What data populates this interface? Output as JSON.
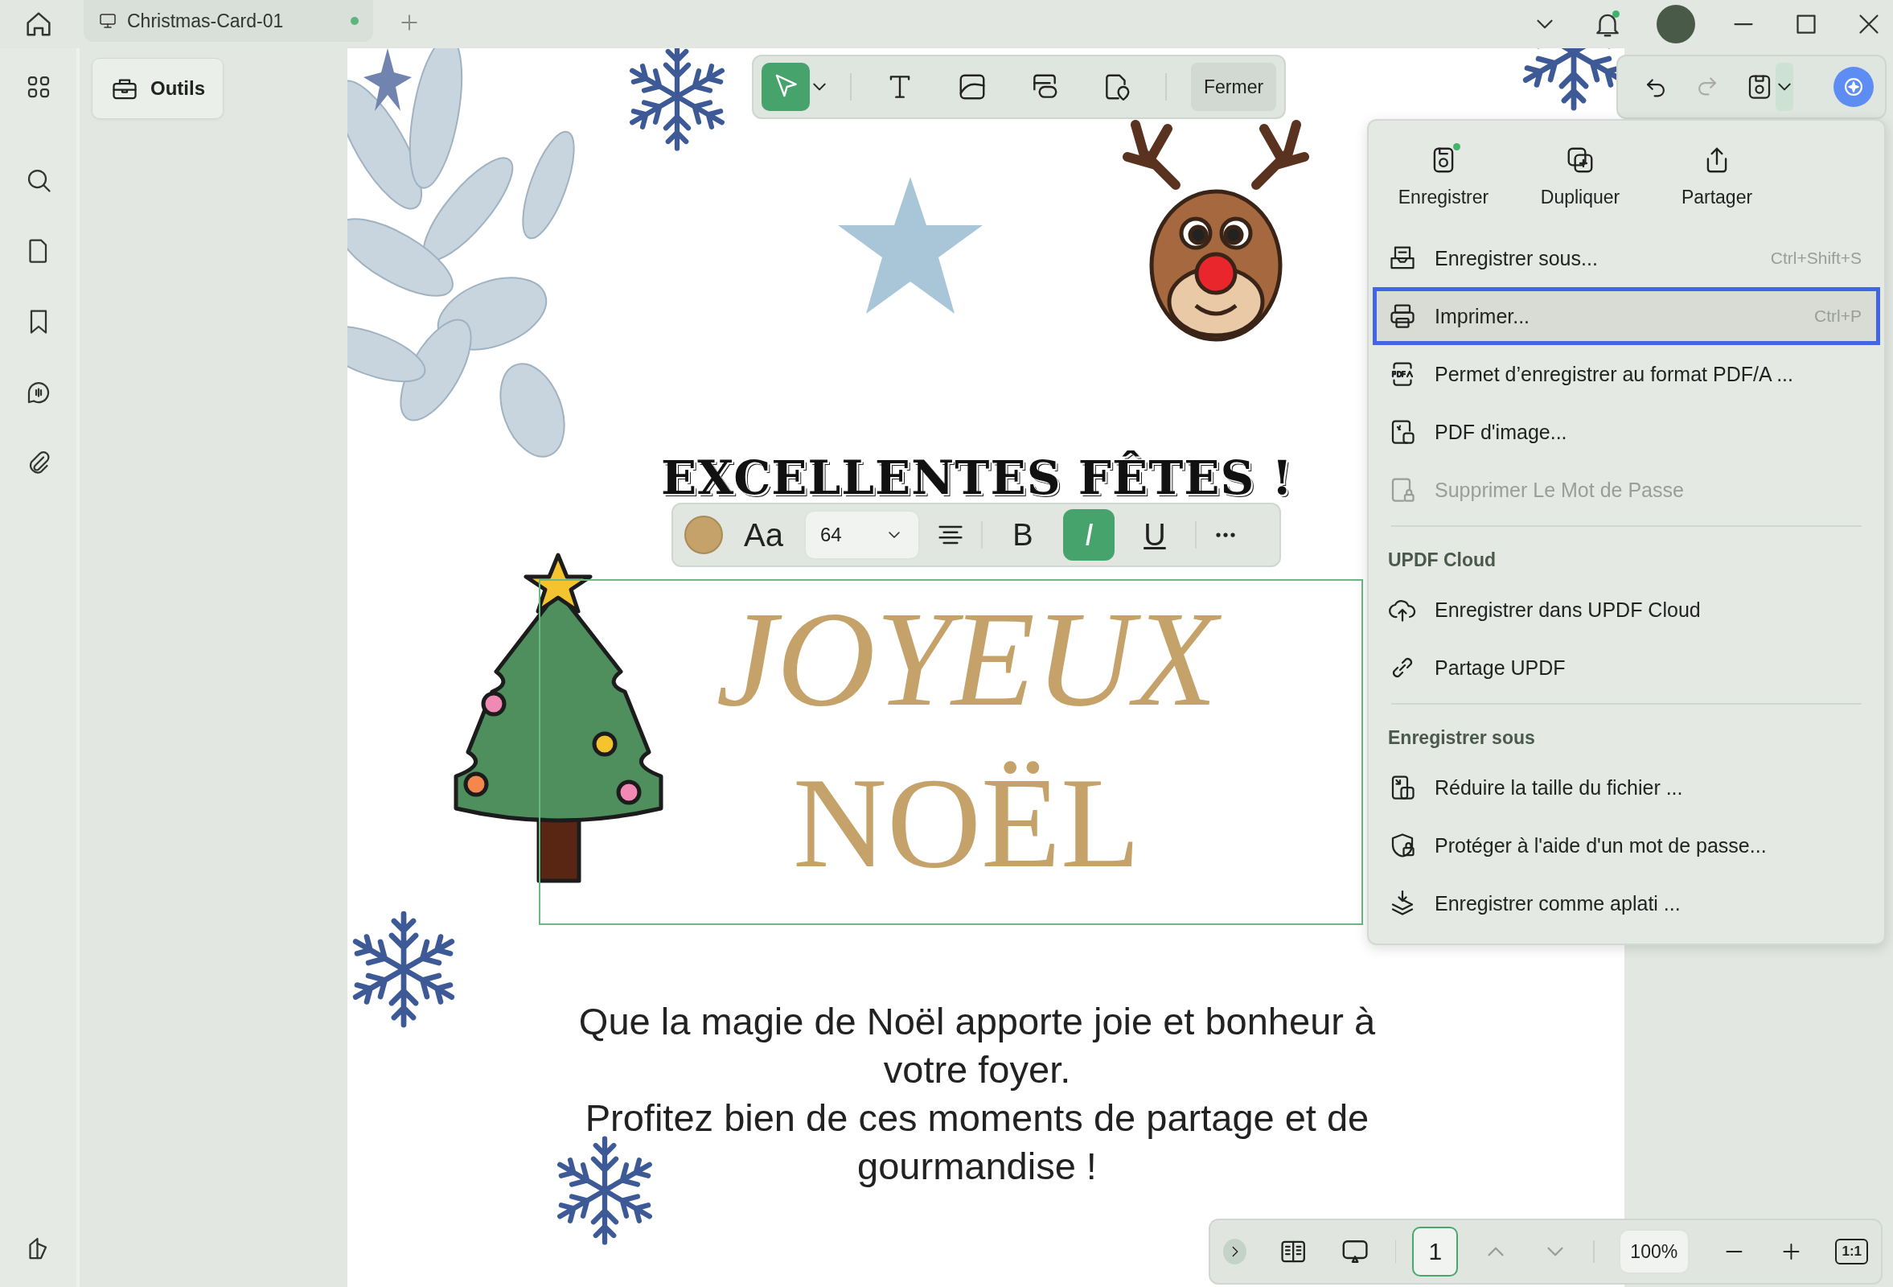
{
  "tab": {
    "title": "Christmas-Card-01",
    "modified": true
  },
  "notifications": {
    "unread": true
  },
  "tools_panel": {
    "button": "Outils"
  },
  "edit_toolbar": {
    "tools": [
      {
        "selected": true
      },
      {
        "selected": false
      },
      {
        "selected": false
      },
      {
        "selected": false
      },
      {
        "selected": false
      }
    ],
    "close": "Fermer"
  },
  "page": {
    "greeting": "EXCELLENTES FÊTES !",
    "title_lines": [
      "JOYEUX",
      "NOËL"
    ],
    "message_lines": [
      "Que la magie de Noël apporte joie et bonheur à",
      "votre foyer.",
      "Profitez bien de ces moments de partage et de",
      "gourmandise !"
    ]
  },
  "text_format": {
    "color": "#c4a26a",
    "font": "Aa",
    "font_size": "64",
    "styles": [
      {
        "label": "B",
        "selected": false
      },
      {
        "label": "I",
        "selected": true
      },
      {
        "label": "U",
        "selected": false
      }
    ]
  },
  "file_menu": {
    "actions": [
      {
        "label": "Enregistrer",
        "modified": true
      },
      {
        "label": "Dupliquer",
        "modified": false
      },
      {
        "label": "Partager",
        "modified": false
      }
    ],
    "sections": [
      {
        "items": [
          {
            "label": "Enregistrer sous...",
            "shortcut": "Ctrl+Shift+S",
            "disabled": false,
            "selected": false
          },
          {
            "label": "Imprimer...",
            "shortcut": "Ctrl+P",
            "disabled": false,
            "selected": true
          },
          {
            "label": "Permet d’enregistrer au format PDF/A ...",
            "disabled": false,
            "selected": false
          },
          {
            "label": "PDF d'image...",
            "disabled": false,
            "selected": false
          },
          {
            "label": "Supprimer Le Mot de Passe",
            "disabled": true,
            "selected": false
          }
        ]
      },
      {
        "title": "UPDF Cloud",
        "items": [
          {
            "label": "Enregistrer dans UPDF Cloud",
            "disabled": false,
            "selected": false
          },
          {
            "label": "Partage UPDF",
            "disabled": false,
            "selected": false
          }
        ]
      },
      {
        "title": "Enregistrer sous",
        "items": [
          {
            "label": "Réduire la taille du fichier ...",
            "disabled": false,
            "selected": false
          },
          {
            "label": "Protéger à l'aide d'un mot de passe...",
            "disabled": false,
            "selected": false
          },
          {
            "label": "Enregistrer comme aplati ...",
            "disabled": false,
            "selected": false
          }
        ]
      }
    ]
  },
  "page_nav": {
    "page": "1",
    "zoom": "100%",
    "actual_size": "1:1"
  }
}
